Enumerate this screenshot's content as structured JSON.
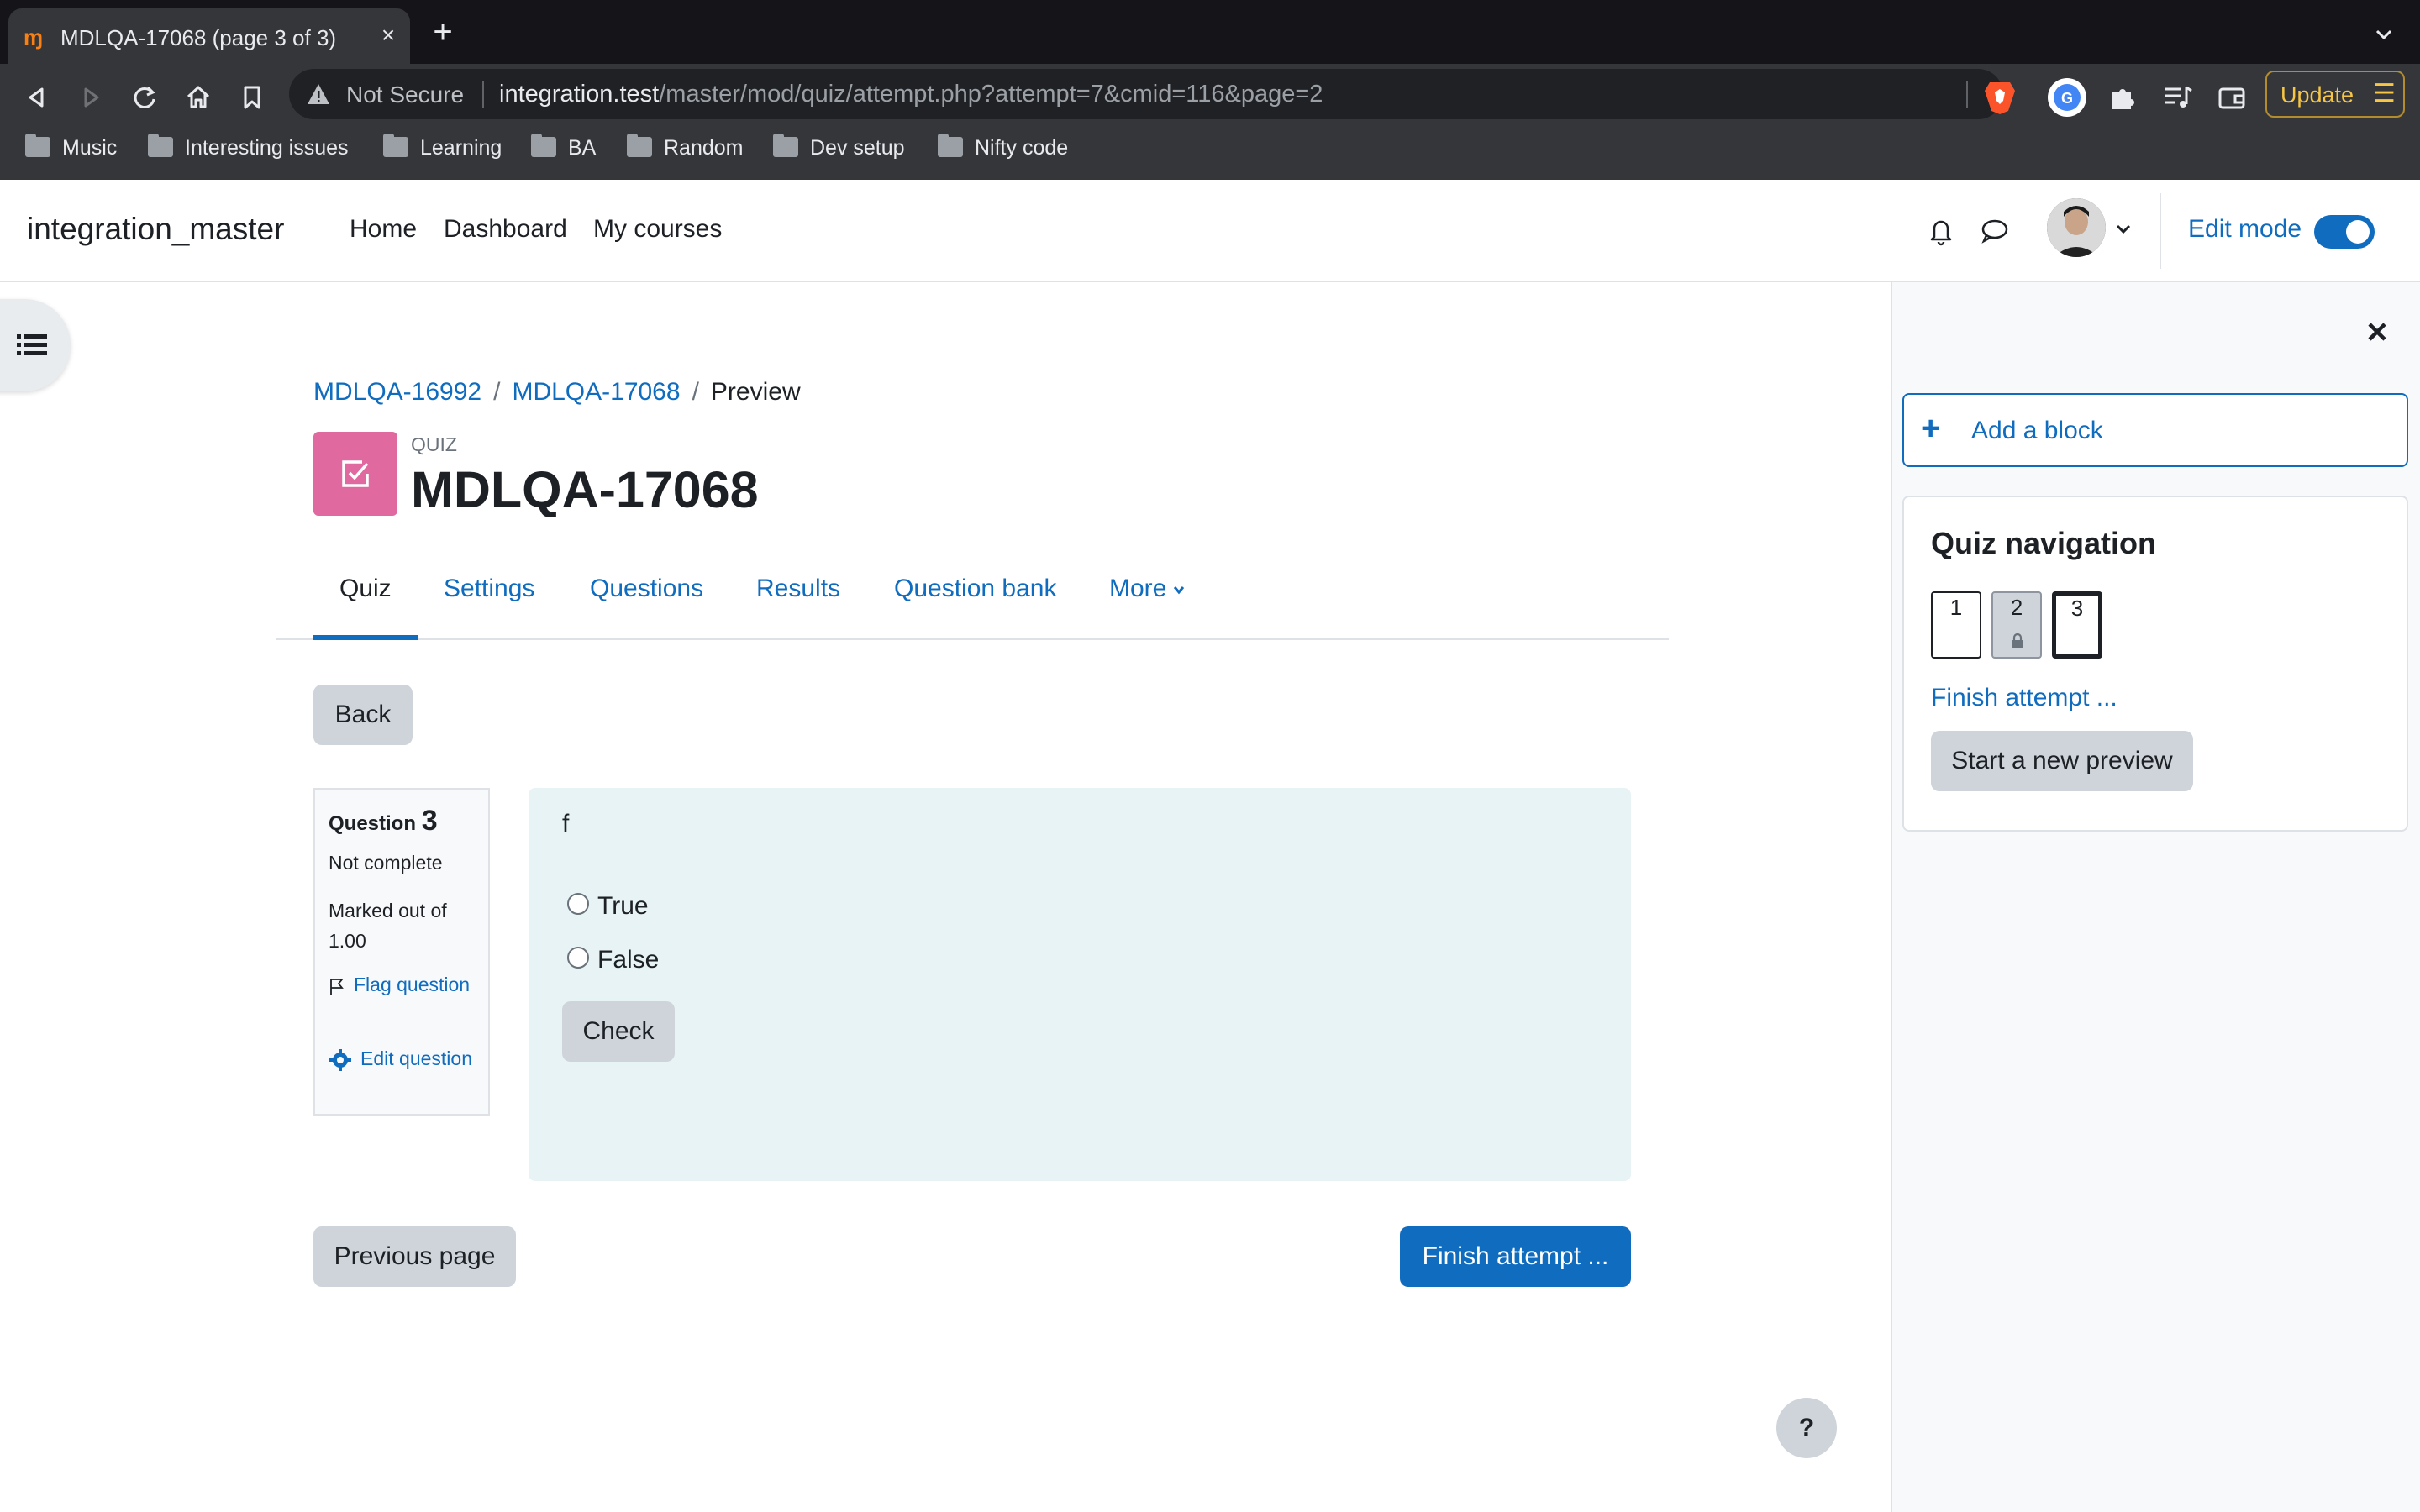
{
  "browser": {
    "tab_title": "MDLQA-17068 (page 3 of 3)",
    "tab_favicon": "moodle-favicon",
    "new_tab_label": "+",
    "security_label": "Not Secure",
    "url_host": "integration.test",
    "url_path": "/master/mod/quiz/attempt.php?attempt=7&cmid=116&page=2",
    "update_label": "Update",
    "bookmarks": [
      "Music",
      "Interesting issues",
      "Learning",
      "BA",
      "Random",
      "Dev setup",
      "Nifty code"
    ],
    "colors": {
      "tab_bg": "#35363a",
      "titlebar": "#141419",
      "update": "#f6c644"
    }
  },
  "navbar": {
    "site_name": "integration_master",
    "items": [
      "Home",
      "Dashboard",
      "My courses"
    ],
    "edit_mode_label": "Edit mode",
    "edit_mode_on": true
  },
  "page": {
    "breadcrumb": [
      "MDLQA-16992",
      "MDLQA-17068",
      "Preview"
    ],
    "module_type": "QUIZ",
    "title": "MDLQA-17068",
    "secondary_nav": [
      "Quiz",
      "Settings",
      "Questions",
      "Results",
      "Question bank",
      "More"
    ],
    "active_tab": "Quiz",
    "back_label": "Back",
    "colors": {
      "accent": "#0f6cbf",
      "quiz_icon": "#e069a0",
      "question_bg": "#e7f3f5"
    }
  },
  "question": {
    "label": "Question",
    "number": "3",
    "state": "Not complete",
    "grade": "Marked out of 1.00",
    "flag_label": "Flag question",
    "edit_label": "Edit question",
    "text": "f",
    "options": [
      "True",
      "False"
    ],
    "check_label": "Check"
  },
  "footer": {
    "previous_label": "Previous page",
    "finish_label": "Finish attempt ...",
    "help_label": "?"
  },
  "drawer": {
    "add_block_label": "Add a block",
    "quiz_nav_title": "Quiz navigation",
    "nav_buttons": [
      {
        "label": "1",
        "state": "normal"
      },
      {
        "label": "2",
        "state": "locked"
      },
      {
        "label": "3",
        "state": "current"
      }
    ],
    "finish_link": "Finish attempt ...",
    "new_preview_label": "Start a new preview"
  }
}
